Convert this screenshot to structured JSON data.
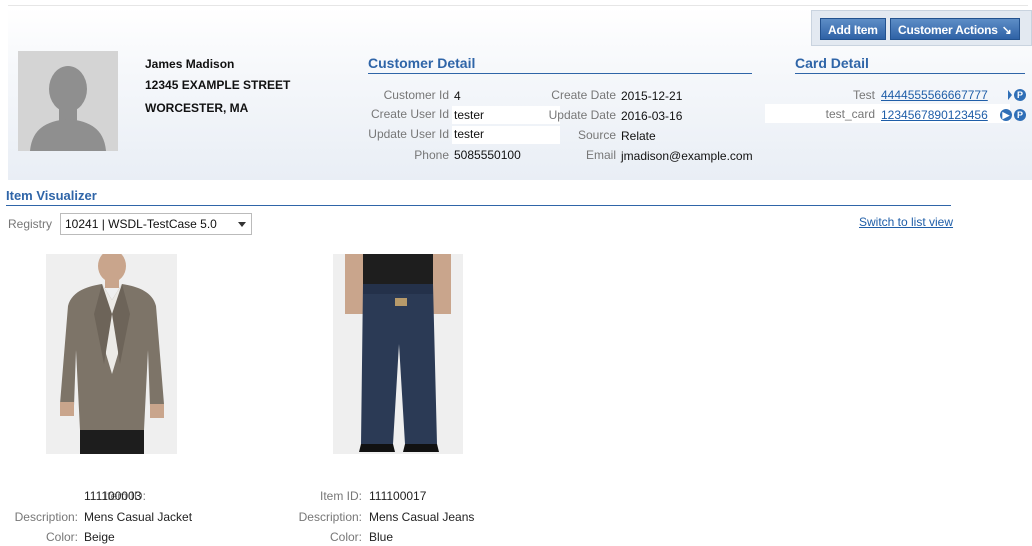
{
  "toolbar": {
    "add_item": "Add Item",
    "customer_actions": "Customer Actions"
  },
  "customer": {
    "name": "James Madison",
    "street": "12345 EXAMPLE STREET",
    "city": "WORCESTER, MA"
  },
  "customer_detail": {
    "title": "Customer Detail",
    "customer_id_label": "Customer Id",
    "customer_id": "4",
    "create_user_label": "Create User Id",
    "create_user": "tester",
    "update_user_label": "Update User Id",
    "update_user": "tester",
    "phone_label": "Phone",
    "phone": "5085550100",
    "create_date_label": "Create Date",
    "create_date": "2015-12-21",
    "update_date_label": "Update Date",
    "update_date": "2016-03-16",
    "source_label": "Source",
    "source": "Relate",
    "email_label": "Email",
    "email": "jmadison@example.com"
  },
  "card_detail": {
    "title": "Card Detail",
    "cards": [
      {
        "label": "Test",
        "number": "4444555566667777"
      },
      {
        "label": "test_card",
        "number": "1234567890123456"
      }
    ]
  },
  "item_visualizer": {
    "title": "Item Visualizer",
    "registry_label": "Registry",
    "registry_value": "10241 | WSDL-TestCase 5.0",
    "switch_view": "Switch to list view",
    "item_id_label": "Item ID:",
    "description_label": "Description:",
    "color_label": "Color:",
    "items": [
      {
        "id": "111100003",
        "description": "Mens Casual Jacket",
        "color": "Beige"
      },
      {
        "id": "111100017",
        "description": "Mens Casual Jeans",
        "color": "Blue"
      }
    ]
  },
  "colors": {
    "accent": "#2f65a8",
    "button": "#2f62a6",
    "jacket": "#7d7468",
    "jeans": "#2b3a55"
  }
}
